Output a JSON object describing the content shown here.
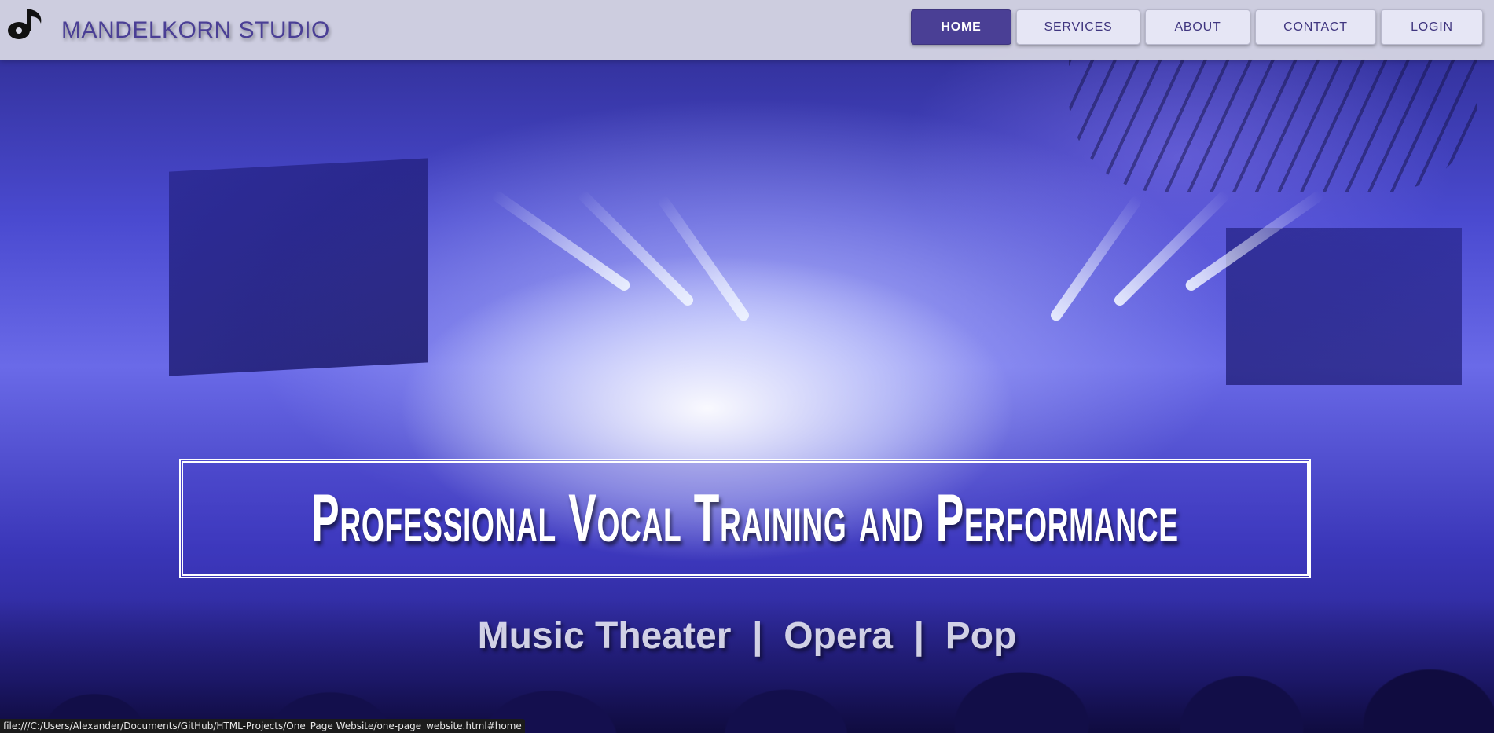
{
  "header": {
    "logo_icon": "music-note-icon",
    "brand_name": "MANDELKORN STUDIO",
    "brand_color": "#4a3f95",
    "nav": [
      {
        "label": "HOME",
        "active": true
      },
      {
        "label": "SERVICES",
        "active": false
      },
      {
        "label": "ABOUT",
        "active": false
      },
      {
        "label": "CONTACT",
        "active": false
      },
      {
        "label": "LOGIN",
        "active": false
      }
    ]
  },
  "hero": {
    "headline": "Professional Vocal Training and Performance",
    "subline": "Music Theater  |  Opera  |  Pop"
  },
  "status_bar": {
    "url": "file:///C:/Users/Alexander/Documents/GitHub/HTML-Projects/One_Page Website/one-page_website.html#home"
  }
}
